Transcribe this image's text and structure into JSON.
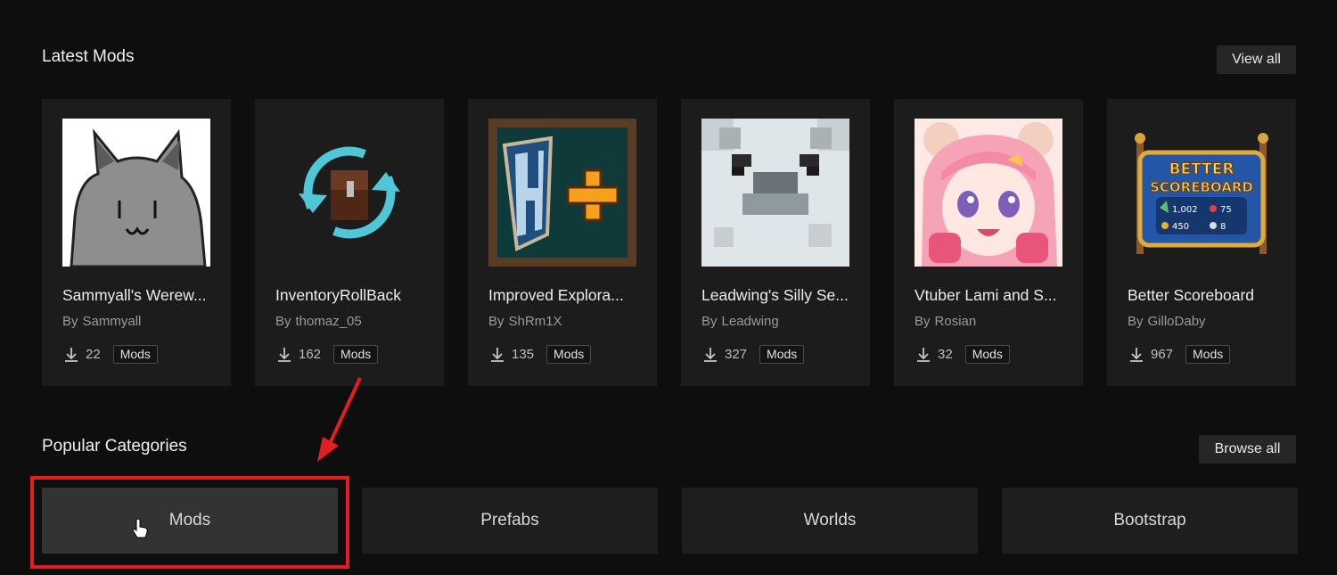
{
  "latest": {
    "title": "Latest Mods",
    "view_all": "View all",
    "cards": [
      {
        "title": "Sammyall's Werew...",
        "by": "By",
        "author": "Sammyall",
        "downloads": "22",
        "tag": "Mods",
        "thumb": "werewolf-cat"
      },
      {
        "title": "InventoryRollBack",
        "by": "By",
        "author": "thomaz_05",
        "downloads": "162",
        "tag": "Mods",
        "thumb": "chest-refresh"
      },
      {
        "title": "Improved Explora...",
        "by": "By",
        "author": "ShRm1X",
        "downloads": "135",
        "tag": "Mods",
        "thumb": "h-plus"
      },
      {
        "title": "Leadwing's Silly Se...",
        "by": "By",
        "author": "Leadwing",
        "downloads": "327",
        "tag": "Mods",
        "thumb": "pixel-seal"
      },
      {
        "title": "Vtuber Lami and S...",
        "by": "By",
        "author": "Rosian",
        "downloads": "32",
        "tag": "Mods",
        "thumb": "anime-girl"
      },
      {
        "title": "Better Scoreboard",
        "by": "By",
        "author": "GilloDaby",
        "downloads": "967",
        "tag": "Mods",
        "thumb": "better-scoreboard"
      }
    ]
  },
  "scoreboard_logo": {
    "line1": "BETTER",
    "line2": "SCOREBOARD",
    "n1": "1,002",
    "n2": "75",
    "n3": "450",
    "n4": "8"
  },
  "categories": {
    "title": "Popular Categories",
    "browse_all": "Browse all",
    "items": [
      {
        "label": "Mods",
        "active": true
      },
      {
        "label": "Prefabs",
        "active": false
      },
      {
        "label": "Worlds",
        "active": false
      },
      {
        "label": "Bootstrap",
        "active": false
      }
    ]
  },
  "colors": {
    "background": "#0e0e0e",
    "card": "#1c1c1c",
    "annotation_red": "#e11f1f"
  }
}
